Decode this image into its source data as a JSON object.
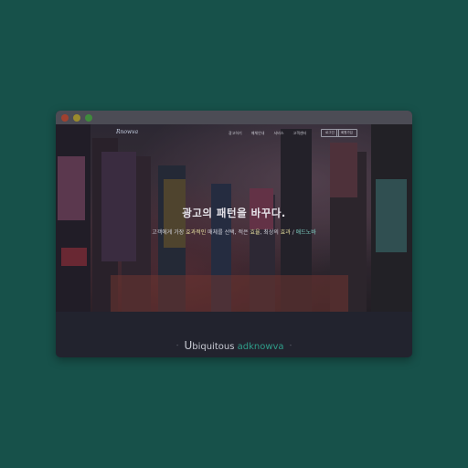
{
  "window": {
    "controls": [
      "close",
      "minimize",
      "maximize"
    ]
  },
  "nav": {
    "logo": "Rnowva",
    "links": [
      "광고하기",
      "매체안내",
      "서비스",
      "고객센터"
    ],
    "login_label": "로그인",
    "signup_label": "회원가입"
  },
  "hero": {
    "title": "광고의 패턴을 바꾸다.",
    "subtitle_part1": "고객에게 가장 ",
    "subtitle_hl1": "효과적인",
    "subtitle_part2": " 매체를 선택, 적은 ",
    "subtitle_hl2": "효율",
    "subtitle_part3": ", 최상의 ",
    "subtitle_hl3": "효과",
    "subtitle_part4": " / ",
    "subtitle_brand": "애드노바"
  },
  "section": {
    "dash_left": "-",
    "title_initial": "U",
    "title_rest": "biquitous",
    "title_accent": "adknowva",
    "dash_right": "-"
  },
  "colors": {
    "background": "#17514a",
    "window": "#22232e",
    "titlebar": "#4c4c55",
    "accent": "#2f9e8a"
  }
}
